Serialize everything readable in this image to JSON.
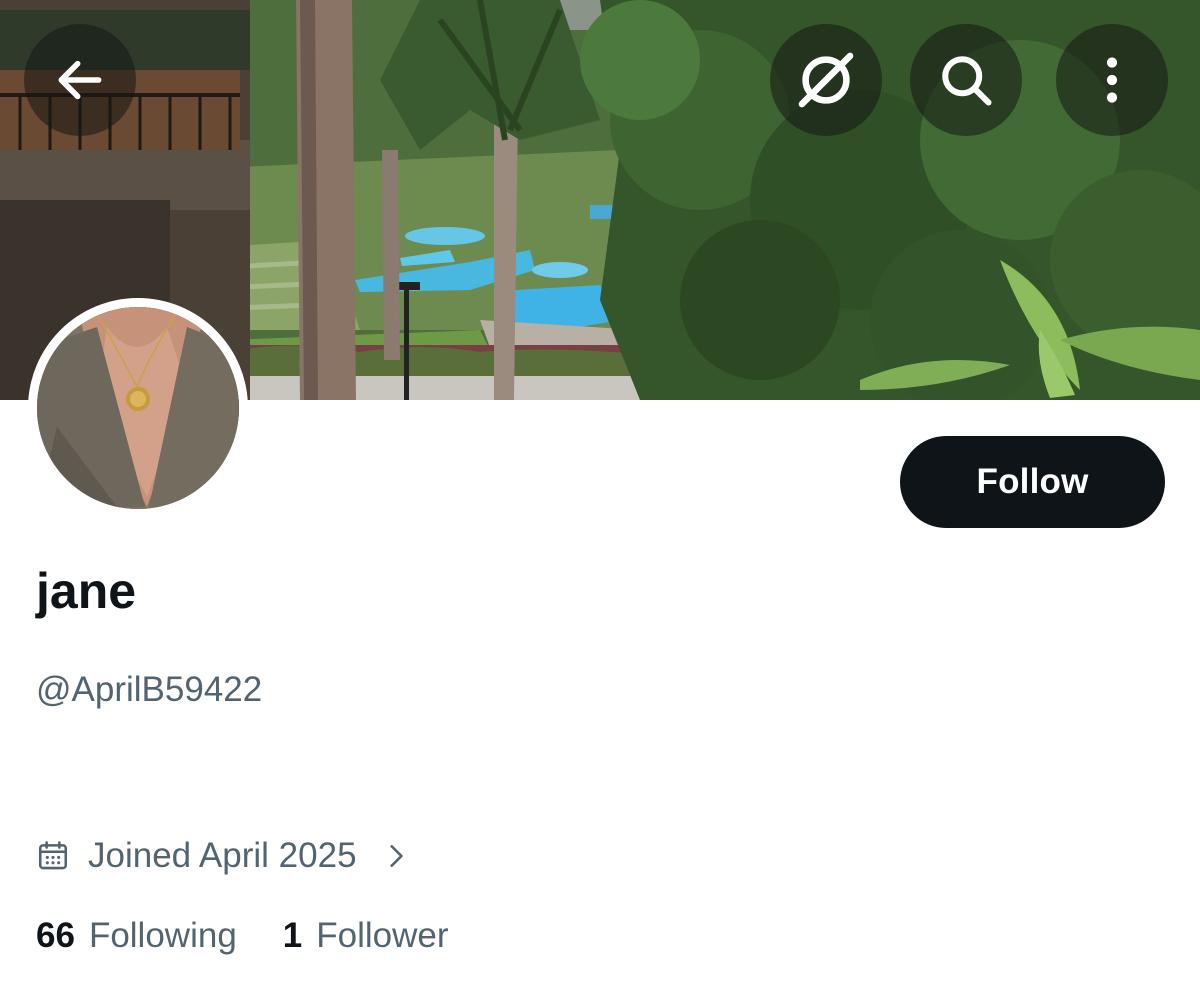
{
  "header": {
    "back_icon": "arrow-left-icon",
    "grok_icon": "grok-slash-icon",
    "search_icon": "search-icon",
    "more_icon": "more-vertical-icon"
  },
  "profile": {
    "display_name": "jane",
    "handle": "@AprilB59422",
    "follow_label": "Follow",
    "joined": {
      "icon": "calendar-icon",
      "text": "Joined April 2025",
      "chevron_icon": "chevron-right-icon"
    },
    "stats": {
      "following_count": "66",
      "following_label": "Following",
      "followers_count": "1",
      "followers_label": "Follower"
    }
  },
  "colors": {
    "primary_text": "#0f1419",
    "secondary_text": "#536471",
    "button_bg": "#0f1419",
    "button_text": "#ffffff",
    "overlay_button": "rgba(20,24,20,0.55)"
  }
}
